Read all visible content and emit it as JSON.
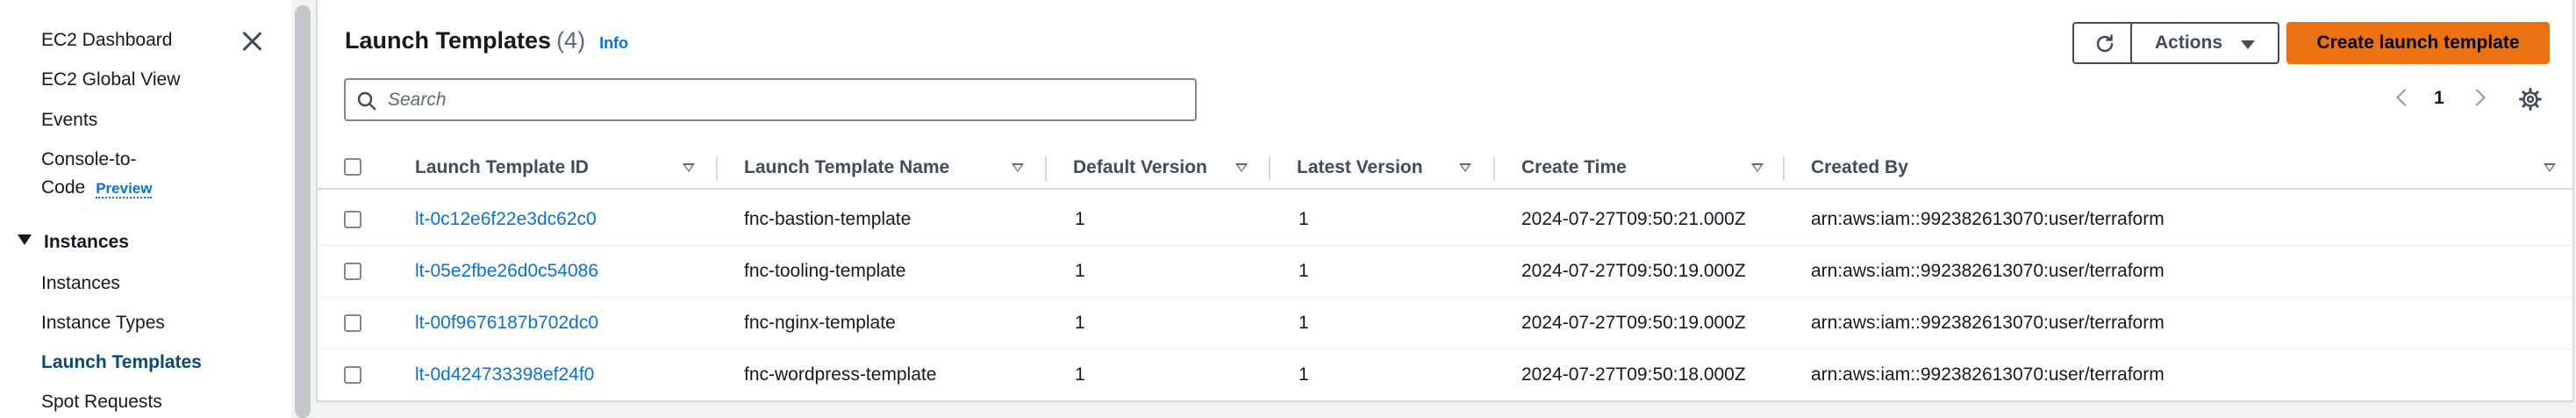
{
  "sidebar": {
    "items": [
      {
        "label": "EC2 Dashboard"
      },
      {
        "label": "EC2 Global View"
      },
      {
        "label": "Events"
      },
      {
        "label": "Console-to-",
        "label2": "Code",
        "badge": "Preview"
      }
    ],
    "section": {
      "label": "Instances"
    },
    "section_items": [
      {
        "label": "Instances"
      },
      {
        "label": "Instance Types"
      },
      {
        "label": "Launch Templates",
        "active": true
      },
      {
        "label": "Spot Requests"
      }
    ]
  },
  "header": {
    "title": "Launch Templates",
    "count": "(4)",
    "info": "Info",
    "actions_label": "Actions",
    "create_label": "Create launch template"
  },
  "search": {
    "placeholder": "Search",
    "value": ""
  },
  "pagination": {
    "current_page": "1"
  },
  "table": {
    "columns": [
      "Launch Template ID",
      "Launch Template Name",
      "Default Version",
      "Latest Version",
      "Create Time",
      "Created By"
    ],
    "rows": [
      {
        "id": "lt-0c12e6f22e3dc62c0",
        "name": "fnc-bastion-template",
        "default_version": "1",
        "latest_version": "1",
        "create_time": "2024-07-27T09:50:21.000Z",
        "created_by": "arn:aws:iam::992382613070:user/terraform"
      },
      {
        "id": "lt-05e2fbe26d0c54086",
        "name": "fnc-tooling-template",
        "default_version": "1",
        "latest_version": "1",
        "create_time": "2024-07-27T09:50:19.000Z",
        "created_by": "arn:aws:iam::992382613070:user/terraform"
      },
      {
        "id": "lt-00f9676187b702dc0",
        "name": "fnc-nginx-template",
        "default_version": "1",
        "latest_version": "1",
        "create_time": "2024-07-27T09:50:19.000Z",
        "created_by": "arn:aws:iam::992382613070:user/terraform"
      },
      {
        "id": "lt-0d424733398ef24f0",
        "name": "fnc-wordpress-template",
        "default_version": "1",
        "latest_version": "1",
        "create_time": "2024-07-27T09:50:18.000Z",
        "created_by": "arn:aws:iam::992382613070:user/terraform"
      }
    ]
  },
  "icons": {
    "close": "close-icon",
    "search": "search-icon",
    "refresh": "refresh-icon",
    "settings": "gear-icon",
    "sort": "sort-icon",
    "expand": "caret-down-icon"
  },
  "colors": {
    "primary_button": "#ec7211",
    "link": "#0972d3",
    "active_nav": "#0a4a74"
  }
}
